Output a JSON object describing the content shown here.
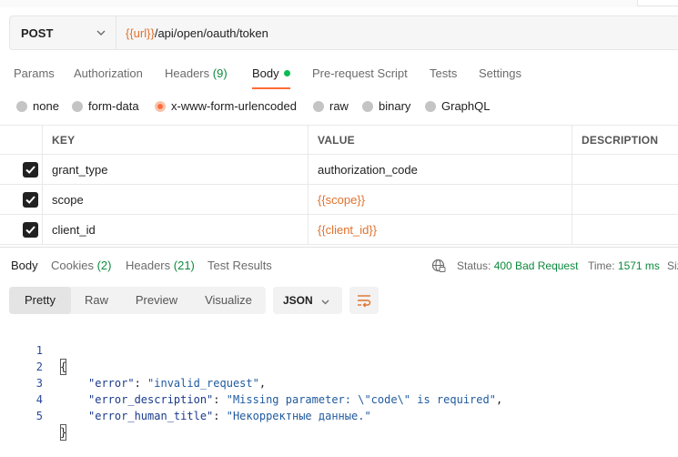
{
  "request": {
    "method": "POST",
    "url_var": "{{url}}",
    "url_path": "/api/open/oauth/token"
  },
  "request_tabs": {
    "params": "Params",
    "authorization": "Authorization",
    "headers": "Headers",
    "headers_count": "(9)",
    "body": "Body",
    "pre_request": "Pre-request Script",
    "tests": "Tests",
    "settings": "Settings"
  },
  "body_types": {
    "none": "none",
    "form_data": "form-data",
    "urlencoded": "x-www-form-urlencoded",
    "raw": "raw",
    "binary": "binary",
    "graphql": "GraphQL",
    "selected": "x-www-form-urlencoded"
  },
  "params_table": {
    "headers": {
      "key": "KEY",
      "value": "VALUE",
      "description": "DESCRIPTION"
    },
    "rows": [
      {
        "checked": true,
        "key": "grant_type",
        "value": "authorization_code"
      },
      {
        "checked": true,
        "key": "scope",
        "value": "{{scope}}"
      },
      {
        "checked": true,
        "key": "client_id",
        "value": "{{client_id}}"
      }
    ]
  },
  "response_tabs": {
    "body": "Body",
    "cookies": "Cookies",
    "cookies_count": "(2)",
    "headers": "Headers",
    "headers_count": "(21)",
    "test_results": "Test Results"
  },
  "response_status": {
    "status_label": "Status:",
    "status_value": "400 Bad Request",
    "time_label": "Time:",
    "time_value": "1571 ms",
    "size_label": "Siz"
  },
  "view_modes": {
    "pretty": "Pretty",
    "raw": "Raw",
    "preview": "Preview",
    "visualize": "Visualize",
    "format": "JSON"
  },
  "response_body": {
    "line_numbers": [
      "1",
      "2",
      "3",
      "4",
      "5"
    ],
    "open_brace": "{",
    "close_brace": "}",
    "error_key": "\"error\"",
    "error_value": "\"invalid_request\"",
    "error_description_key": "\"error_description\"",
    "error_description_value": "\"Missing parameter: \\\"code\\\" is required\"",
    "error_human_title_key": "\"error_human_title\"",
    "error_human_title_value": "\"Некорректные данные.\""
  },
  "colors": {
    "accent": "#ff6c37",
    "variable": "#e0712c",
    "success_green": "#0c8a3c",
    "body_dot": "#0cbb52"
  },
  "icons": [
    "chevron-down-icon",
    "checkbox-checked-icon",
    "globe-icon",
    "wrap-lines-icon"
  ]
}
